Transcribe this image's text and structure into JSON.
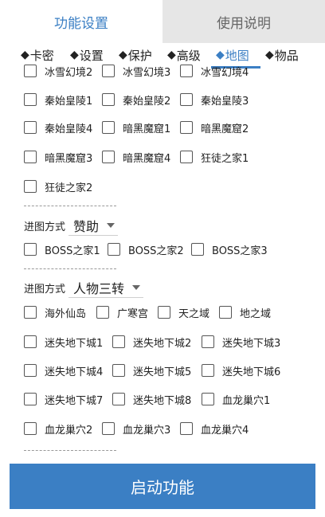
{
  "top_tabs": {
    "settings": "功能设置",
    "instructions": "使用说明"
  },
  "sub_tabs": [
    "卡密",
    "设置",
    "保护",
    "高级",
    "地图",
    "物品"
  ],
  "active_sub_tab": "地图",
  "diamond": "◆",
  "map_group_1": [
    "冰雪幻境2",
    "冰雪幻境3",
    "冰雪幻境4",
    "秦始皇陵1",
    "秦始皇陵2",
    "秦始皇陵3",
    "秦始皇陵4",
    "暗黑魔窟1",
    "暗黑魔窟2",
    "暗黑魔窟3",
    "暗黑魔窟4",
    "狂徒之家1",
    "狂徒之家2"
  ],
  "entry_mode_label": "进图方式",
  "mode_1": "赞助",
  "boss_maps": [
    "BOSS之家1",
    "BOSS之家2",
    "BOSS之家3"
  ],
  "mode_2": "人物三转",
  "map_group_2": [
    "海外仙岛",
    "广寒宫",
    "天之域",
    "地之域",
    "迷失地下城1",
    "迷失地下城2",
    "迷失地下城3",
    "迷失地下城4",
    "迷失地下城5",
    "迷失地下城6",
    "迷失地下城7",
    "迷失地下城8",
    "血龙巢穴1",
    "血龙巢穴2",
    "血龙巢穴3",
    "血龙巢穴4"
  ],
  "start_button": "启动功能",
  "colors": {
    "accent": "#3b7fc4",
    "inactive_tab": "#e6e6e6"
  }
}
